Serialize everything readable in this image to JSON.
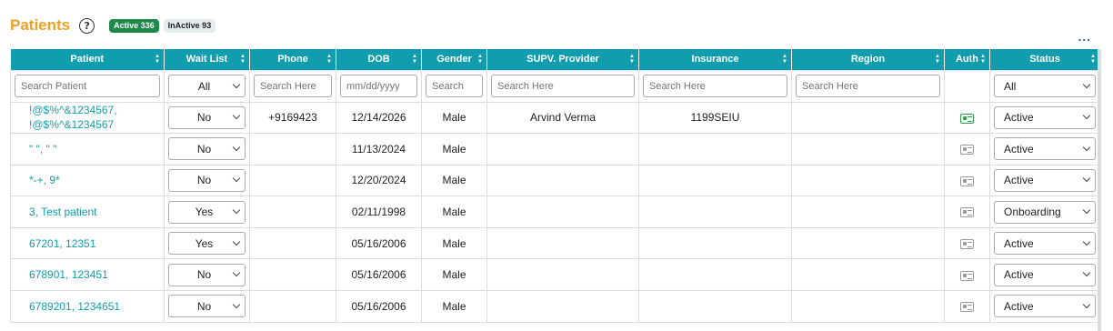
{
  "header": {
    "title": "Patients",
    "help_glyph": "?",
    "active_badge": "Active 336",
    "inactive_badge": "InActive 93",
    "more_glyph": "..."
  },
  "columns": [
    "Patient",
    "Wait List",
    "Phone",
    "DOB",
    "Gender",
    "SUPV. Provider",
    "Insurance",
    "Region",
    "Auth",
    "Status"
  ],
  "filters": {
    "patient_placeholder": "Search Patient",
    "waitlist_value": "All",
    "phone_placeholder": "Search Here",
    "dob_placeholder": "mm/dd/yyyy",
    "gender_placeholder": "Search",
    "provider_placeholder": "Search Here",
    "insurance_placeholder": "Search Here",
    "region_placeholder": "Search Here",
    "status_value": "All"
  },
  "rows": [
    {
      "patient": "!@$%^&1234567, !@$%^&1234567",
      "waitlist": "No",
      "phone": "+9169423",
      "dob": "12/14/2026",
      "gender": "Male",
      "provider": "Arvind Verma",
      "insurance": "1199SEIU",
      "region": "",
      "auth_icon": "id-card-icon-green",
      "status": "Active"
    },
    {
      "patient": "\" \", \" \"",
      "waitlist": "No",
      "phone": "",
      "dob": "11/13/2024",
      "gender": "Male",
      "provider": "",
      "insurance": "",
      "region": "",
      "auth_icon": "id-card-icon",
      "status": "Active"
    },
    {
      "patient": "*-+, 9*",
      "waitlist": "No",
      "phone": "",
      "dob": "12/20/2024",
      "gender": "Male",
      "provider": "",
      "insurance": "",
      "region": "",
      "auth_icon": "id-card-icon",
      "status": "Active"
    },
    {
      "patient": "3, Test patient",
      "waitlist": "Yes",
      "phone": "",
      "dob": "02/11/1998",
      "gender": "Male",
      "provider": "",
      "insurance": "",
      "region": "",
      "auth_icon": "id-card-icon",
      "status": "Onboarding"
    },
    {
      "patient": "67201, 12351",
      "waitlist": "Yes",
      "phone": "",
      "dob": "05/16/2006",
      "gender": "Male",
      "provider": "",
      "insurance": "",
      "region": "",
      "auth_icon": "id-card-icon",
      "status": "Active"
    },
    {
      "patient": "678901, 123451",
      "waitlist": "No",
      "phone": "",
      "dob": "05/16/2006",
      "gender": "Male",
      "provider": "",
      "insurance": "",
      "region": "",
      "auth_icon": "id-card-icon",
      "status": "Active"
    },
    {
      "patient": "6789201, 1234651",
      "waitlist": "No",
      "phone": "",
      "dob": "05/16/2006",
      "gender": "Male",
      "provider": "",
      "insurance": "",
      "region": "",
      "auth_icon": "id-card-icon",
      "status": "Active"
    }
  ]
}
